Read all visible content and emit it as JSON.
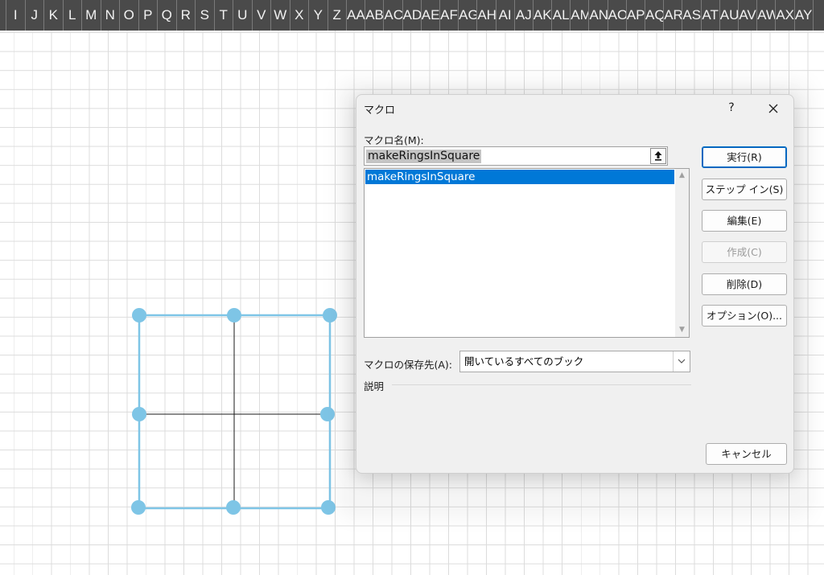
{
  "sheet": {
    "columns": [
      "I",
      "J",
      "K",
      "L",
      "M",
      "N",
      "O",
      "P",
      "Q",
      "R",
      "S",
      "T",
      "U",
      "V",
      "W",
      "X",
      "Y",
      "Z",
      "AA",
      "AB",
      "AC",
      "AD",
      "AE",
      "AF",
      "AG",
      "AH",
      "AI",
      "AJ",
      "AK",
      "AL",
      "AM",
      "AN",
      "AO",
      "AP",
      "AQ",
      "AR",
      "AS",
      "AT",
      "AU",
      "AV",
      "AW",
      "AX",
      "AY"
    ],
    "shape_color": "#7ec5e6",
    "header_bg": "#4a4a4a"
  },
  "dialog": {
    "title": "マクロ",
    "help_label": "?",
    "name_label": "マクロ名(M):",
    "name_value": "makeRingsInSquare",
    "list_items": [
      "makeRingsInSquare"
    ],
    "buttons": {
      "run": "実行(R)",
      "step_in": "ステップ イン(S)",
      "edit": "編集(E)",
      "create": "作成(C)",
      "delete": "削除(D)",
      "options": "オプション(O)...",
      "cancel": "キャンセル"
    },
    "location_label": "マクロの保存先(A):",
    "location_value": "開いているすべてのブック",
    "description_label": "説明",
    "accent": "#0078d7"
  }
}
